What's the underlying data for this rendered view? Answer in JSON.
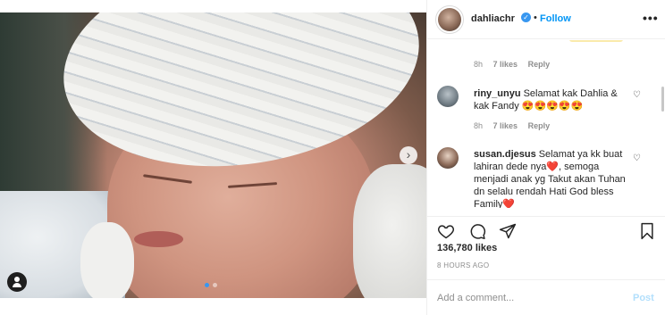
{
  "post": {
    "username": "dahliachr",
    "follow_label": "Follow",
    "bullet": "•",
    "more_label": "•••",
    "next_arrow": "›",
    "likes": "136,780 likes",
    "time_ago": "8 HOURS AGO",
    "add_comment_placeholder": "Add a comment...",
    "post_label": "Post"
  },
  "comments": [
    {
      "partial": true,
      "time": "8h",
      "likes": "7 likes",
      "reply": "Reply"
    },
    {
      "username": "riny_unyu",
      "text": "Selamat kak Dahlia & kak Fandy 😍😍😍😍😍",
      "time": "8h",
      "likes": "7 likes",
      "reply": "Reply"
    },
    {
      "username": "susan.djesus",
      "text": "Selamat ya kk buat lahiran dede nya❤️, semoga menjadi anak yg Takut akan Tuhan dn selalu rendah Hati God bless Family❤️"
    }
  ],
  "icons": [
    "heart-icon",
    "comment-icon",
    "share-icon",
    "bookmark-icon",
    "verified-icon",
    "more-icon",
    "user-tag-icon",
    "next-arrow-icon"
  ],
  "colors": {
    "follow": "#0095f6",
    "verified": "#3897f0",
    "muted": "#8e8e8e",
    "post_disabled": "#b2dffc"
  }
}
